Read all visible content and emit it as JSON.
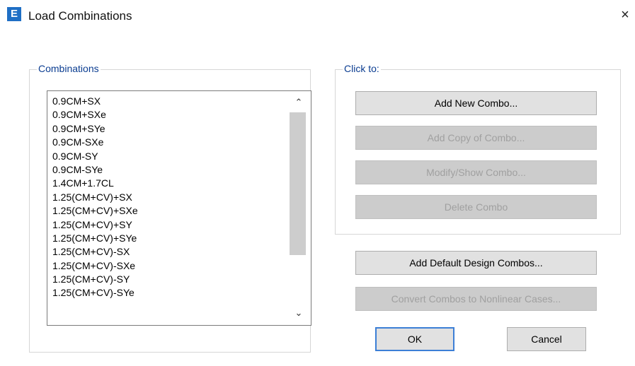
{
  "window": {
    "app_icon_letter": "E",
    "title": "Load Combinations",
    "close_glyph": "×"
  },
  "combinations": {
    "label": "Combinations",
    "items": [
      "0.9CM+SX",
      "0.9CM+SXe",
      "0.9CM+SYe",
      "0.9CM-SXe",
      "0.9CM-SY",
      "0.9CM-SYe",
      "1.4CM+1.7CL",
      "1.25(CM+CV)+SX",
      "1.25(CM+CV)+SXe",
      "1.25(CM+CV)+SY",
      "1.25(CM+CV)+SYe",
      "1.25(CM+CV)-SX",
      "1.25(CM+CV)-SXe",
      "1.25(CM+CV)-SY",
      "1.25(CM+CV)-SYe"
    ],
    "scroll_up_glyph": "⌃",
    "scroll_down_glyph": "⌄"
  },
  "click_to": {
    "label": "Click to:",
    "add_new": "Add New Combo...",
    "add_copy": "Add Copy of Combo...",
    "modify": "Modify/Show Combo...",
    "delete": "Delete Combo"
  },
  "actions": {
    "add_default": "Add Default Design Combos...",
    "convert": "Convert Combos to Nonlinear Cases...",
    "ok": "OK",
    "cancel": "Cancel"
  }
}
